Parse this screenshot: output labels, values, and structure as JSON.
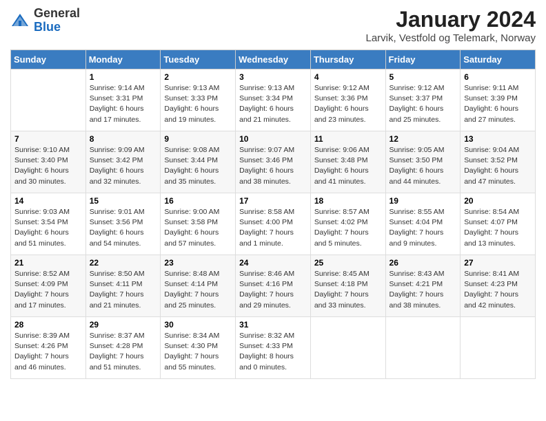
{
  "header": {
    "logo_general": "General",
    "logo_blue": "Blue",
    "month_title": "January 2024",
    "location": "Larvik, Vestfold og Telemark, Norway"
  },
  "days_of_week": [
    "Sunday",
    "Monday",
    "Tuesday",
    "Wednesday",
    "Thursday",
    "Friday",
    "Saturday"
  ],
  "weeks": [
    [
      {
        "day": "",
        "info": ""
      },
      {
        "day": "1",
        "info": "Sunrise: 9:14 AM\nSunset: 3:31 PM\nDaylight: 6 hours\nand 17 minutes."
      },
      {
        "day": "2",
        "info": "Sunrise: 9:13 AM\nSunset: 3:33 PM\nDaylight: 6 hours\nand 19 minutes."
      },
      {
        "day": "3",
        "info": "Sunrise: 9:13 AM\nSunset: 3:34 PM\nDaylight: 6 hours\nand 21 minutes."
      },
      {
        "day": "4",
        "info": "Sunrise: 9:12 AM\nSunset: 3:36 PM\nDaylight: 6 hours\nand 23 minutes."
      },
      {
        "day": "5",
        "info": "Sunrise: 9:12 AM\nSunset: 3:37 PM\nDaylight: 6 hours\nand 25 minutes."
      },
      {
        "day": "6",
        "info": "Sunrise: 9:11 AM\nSunset: 3:39 PM\nDaylight: 6 hours\nand 27 minutes."
      }
    ],
    [
      {
        "day": "7",
        "info": "Sunrise: 9:10 AM\nSunset: 3:40 PM\nDaylight: 6 hours\nand 30 minutes."
      },
      {
        "day": "8",
        "info": "Sunrise: 9:09 AM\nSunset: 3:42 PM\nDaylight: 6 hours\nand 32 minutes."
      },
      {
        "day": "9",
        "info": "Sunrise: 9:08 AM\nSunset: 3:44 PM\nDaylight: 6 hours\nand 35 minutes."
      },
      {
        "day": "10",
        "info": "Sunrise: 9:07 AM\nSunset: 3:46 PM\nDaylight: 6 hours\nand 38 minutes."
      },
      {
        "day": "11",
        "info": "Sunrise: 9:06 AM\nSunset: 3:48 PM\nDaylight: 6 hours\nand 41 minutes."
      },
      {
        "day": "12",
        "info": "Sunrise: 9:05 AM\nSunset: 3:50 PM\nDaylight: 6 hours\nand 44 minutes."
      },
      {
        "day": "13",
        "info": "Sunrise: 9:04 AM\nSunset: 3:52 PM\nDaylight: 6 hours\nand 47 minutes."
      }
    ],
    [
      {
        "day": "14",
        "info": "Sunrise: 9:03 AM\nSunset: 3:54 PM\nDaylight: 6 hours\nand 51 minutes."
      },
      {
        "day": "15",
        "info": "Sunrise: 9:01 AM\nSunset: 3:56 PM\nDaylight: 6 hours\nand 54 minutes."
      },
      {
        "day": "16",
        "info": "Sunrise: 9:00 AM\nSunset: 3:58 PM\nDaylight: 6 hours\nand 57 minutes."
      },
      {
        "day": "17",
        "info": "Sunrise: 8:58 AM\nSunset: 4:00 PM\nDaylight: 7 hours\nand 1 minute."
      },
      {
        "day": "18",
        "info": "Sunrise: 8:57 AM\nSunset: 4:02 PM\nDaylight: 7 hours\nand 5 minutes."
      },
      {
        "day": "19",
        "info": "Sunrise: 8:55 AM\nSunset: 4:04 PM\nDaylight: 7 hours\nand 9 minutes."
      },
      {
        "day": "20",
        "info": "Sunrise: 8:54 AM\nSunset: 4:07 PM\nDaylight: 7 hours\nand 13 minutes."
      }
    ],
    [
      {
        "day": "21",
        "info": "Sunrise: 8:52 AM\nSunset: 4:09 PM\nDaylight: 7 hours\nand 17 minutes."
      },
      {
        "day": "22",
        "info": "Sunrise: 8:50 AM\nSunset: 4:11 PM\nDaylight: 7 hours\nand 21 minutes."
      },
      {
        "day": "23",
        "info": "Sunrise: 8:48 AM\nSunset: 4:14 PM\nDaylight: 7 hours\nand 25 minutes."
      },
      {
        "day": "24",
        "info": "Sunrise: 8:46 AM\nSunset: 4:16 PM\nDaylight: 7 hours\nand 29 minutes."
      },
      {
        "day": "25",
        "info": "Sunrise: 8:45 AM\nSunset: 4:18 PM\nDaylight: 7 hours\nand 33 minutes."
      },
      {
        "day": "26",
        "info": "Sunrise: 8:43 AM\nSunset: 4:21 PM\nDaylight: 7 hours\nand 38 minutes."
      },
      {
        "day": "27",
        "info": "Sunrise: 8:41 AM\nSunset: 4:23 PM\nDaylight: 7 hours\nand 42 minutes."
      }
    ],
    [
      {
        "day": "28",
        "info": "Sunrise: 8:39 AM\nSunset: 4:26 PM\nDaylight: 7 hours\nand 46 minutes."
      },
      {
        "day": "29",
        "info": "Sunrise: 8:37 AM\nSunset: 4:28 PM\nDaylight: 7 hours\nand 51 minutes."
      },
      {
        "day": "30",
        "info": "Sunrise: 8:34 AM\nSunset: 4:30 PM\nDaylight: 7 hours\nand 55 minutes."
      },
      {
        "day": "31",
        "info": "Sunrise: 8:32 AM\nSunset: 4:33 PM\nDaylight: 8 hours\nand 0 minutes."
      },
      {
        "day": "",
        "info": ""
      },
      {
        "day": "",
        "info": ""
      },
      {
        "day": "",
        "info": ""
      }
    ]
  ]
}
